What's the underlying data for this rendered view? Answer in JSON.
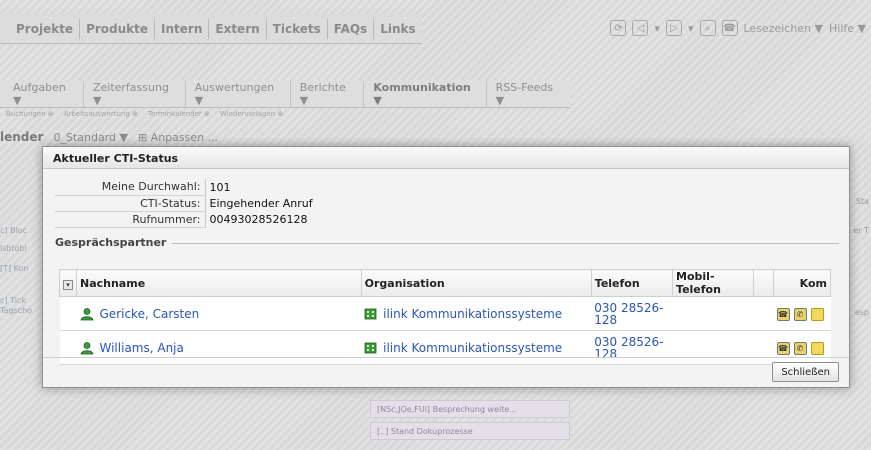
{
  "topnav": {
    "tabs": [
      "Projekte",
      "Produkte",
      "Intern",
      "Extern",
      "Tickets",
      "FAQs",
      "Links"
    ],
    "bookmarks_label": "Lesezeichen ▼",
    "help_label": "Hilfe ▼"
  },
  "menubar": {
    "items": [
      "Aufgaben ▼",
      "Zeiterfassung ▼",
      "Auswertungen ▼",
      "Berichte ▼",
      "Kommunikation ▼",
      "RSS-Feeds ▼"
    ],
    "active_index": 4
  },
  "subtabs": [
    "Buchungen ⊗",
    "Arbeitsauswertung ⊗",
    "Terminkalender ⊗",
    "Wiedervorlagen ⊗"
  ],
  "viewbar": {
    "title": "lender",
    "view": "0_Standard ▼",
    "customize": "⊞ Anpassen ..."
  },
  "background_fragments": {
    "left": [
      "c] Bloc",
      "lsbtobl",
      "[T] Kon",
      "c] Tick",
      "Tagscho"
    ],
    "right": [
      "Sta",
      "er T",
      "esp"
    ],
    "calendar_items": [
      "[NSc,JOe,FUl] Besprechung weite...",
      "[..] Stand Dokuprozesse"
    ]
  },
  "modal": {
    "title": "Aktueller CTI-Status",
    "status_rows": [
      {
        "label": "Meine Durchwahl:",
        "value": "101"
      },
      {
        "label": "CTI-Status:",
        "value": "Eingehender Anruf"
      },
      {
        "label": "Rufnummer:",
        "value": "00493028526128"
      }
    ],
    "group_title": "Gesprächspartner",
    "columns": {
      "name": "Nachname",
      "org": "Organisation",
      "phone": "Telefon",
      "mobile": "Mobil-Telefon",
      "kom": "Kom"
    },
    "rows": [
      {
        "name": "Gericke, Carsten",
        "org": "ilink Kommunikationssysteme",
        "phone_line1": "030 28526-",
        "phone_line2": "128",
        "mobile": ""
      },
      {
        "name": "Williams, Anja",
        "org": "ilink Kommunikationssysteme",
        "phone_line1": "030 28526-",
        "phone_line2": "128",
        "mobile": ""
      }
    ],
    "close_label": "Schließen"
  }
}
